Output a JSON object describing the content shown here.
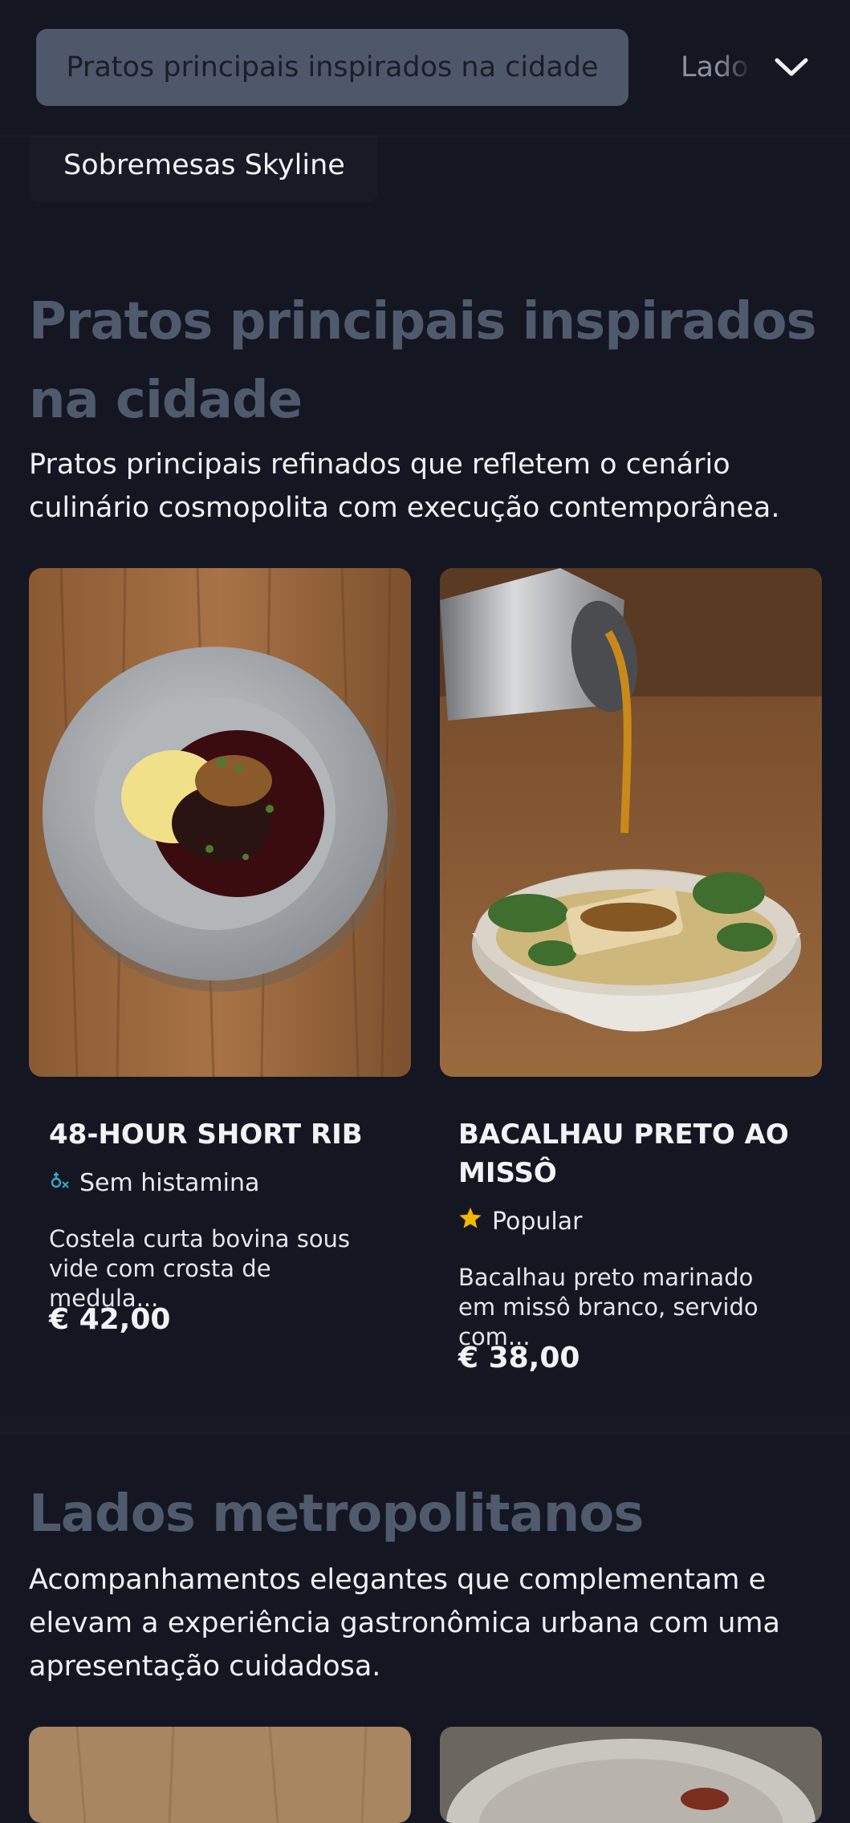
{
  "nav": {
    "active_tab": "Pratos principais inspirados na cidade",
    "next_tab": "Lados metropolitanos",
    "chevron_icon": "chevron-down-icon"
  },
  "category_pill": "Sobremesas Skyline",
  "mains": {
    "title": "Pratos principais inspirados na cidade",
    "description": "Pratos principais refinados que refletem o cenário culinário cosmopolita com execução contemporânea.",
    "items": [
      {
        "name": "48-HOUR SHORT RIB",
        "tag_icon": "histamine-free-icon",
        "tag": "Sem histamina",
        "description": "Costela curta bovina sous vide com crosta de medula...",
        "price": "€ 42,00"
      },
      {
        "name": "BACALHAU PRETO AO MISSÔ",
        "tag_icon": "star-icon",
        "tag": "Popular",
        "description": "Bacalhau preto marinado em missô branco, servido com...",
        "price": "€ 38,00"
      }
    ]
  },
  "sides": {
    "title": "Lados metropolitanos",
    "description": "Acompanhamentos elegantes que complementam e elevam a experiência gastronômica urbana com uma apresentação cuidadosa."
  },
  "colors": {
    "background": "#141722",
    "tab_active": "#4e586a",
    "section_title": "#4f5a6d",
    "star": "#f5b800",
    "histamine_icon": "#3aa6c9"
  }
}
